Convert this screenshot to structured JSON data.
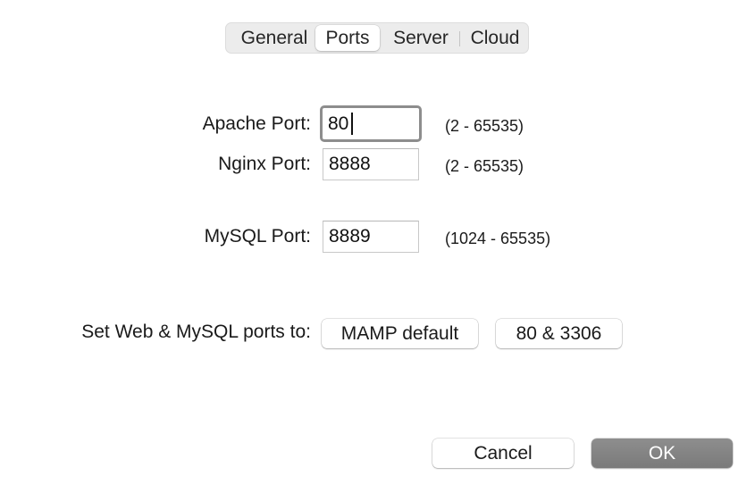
{
  "tabs": [
    {
      "label": "General",
      "selected": false
    },
    {
      "label": "Ports",
      "selected": true
    },
    {
      "label": "Server",
      "selected": false
    },
    {
      "label": "Cloud",
      "selected": false
    }
  ],
  "ports": {
    "apache": {
      "label": "Apache Port:",
      "value": "80",
      "range": "(2 - 65535)",
      "focused": true
    },
    "nginx": {
      "label": "Nginx Port:",
      "value": "8888",
      "range": "(2 - 65535)"
    },
    "mysql": {
      "label": "MySQL Port:",
      "value": "8889",
      "range": "(1024 - 65535)"
    }
  },
  "presets": {
    "label": "Set Web & MySQL ports to:",
    "mamp_default_label": "MAMP default",
    "standard_label": "80 & 3306"
  },
  "footer": {
    "cancel_label": "Cancel",
    "ok_label": "OK"
  },
  "colors": {
    "focus_ring": "#8d8d8d",
    "ok_button": "#858585",
    "tab_track": "#ececec"
  }
}
